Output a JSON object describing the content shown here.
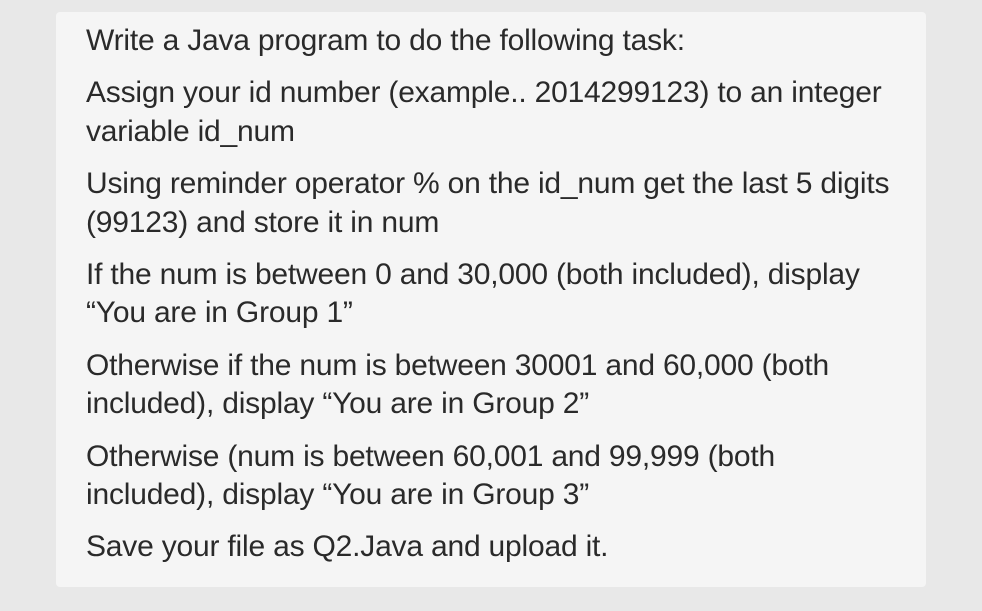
{
  "paragraphs": {
    "p1": "Write a Java program to do the following task:",
    "p2": "Assign your id number (example.. 2014299123) to an integer variable id_num",
    "p3": "Using reminder operator % on the id_num get the last 5 digits (99123) and store it in num",
    "p4": "If the num is between 0 and 30,000 (both included), display “You are in Group 1”",
    "p5": "Otherwise if the num is between 30001 and 60,000 (both included), display “You are in Group 2”",
    "p6": "Otherwise (num is between 60,001 and 99,999 (both included), display “You are in Group 3”",
    "p7": "Save your file as Q2.Java and upload it."
  }
}
